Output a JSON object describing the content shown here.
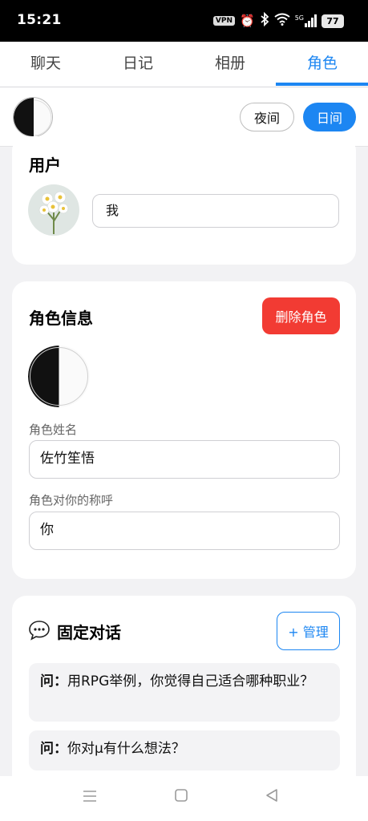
{
  "status_bar": {
    "time": "15:21",
    "vpn": "VPN",
    "network": "5G",
    "battery": "77"
  },
  "tabs": [
    {
      "label": "聊天"
    },
    {
      "label": "日记"
    },
    {
      "label": "相册"
    },
    {
      "label": "角色"
    }
  ],
  "active_tab": "角色",
  "mode": {
    "night_label": "夜间",
    "day_label": "日间",
    "selected": "日间"
  },
  "user_card": {
    "title": "用户",
    "name_value": "我"
  },
  "role_card": {
    "title": "角色信息",
    "delete_label": "删除角色",
    "name_label": "角色姓名",
    "name_value": "佐竹笙悟",
    "address_label": "角色对你的称呼",
    "address_value": "你"
  },
  "pinned_card": {
    "title": "固定对话",
    "manage_label": "+ 管理",
    "items": [
      {
        "prefix": "问：",
        "text": "用RPG举例，你觉得自己适合哪种职业？"
      },
      {
        "prefix": "问：",
        "text": "你对μ有什么想法？"
      }
    ]
  },
  "colors": {
    "accent": "#1c86f2",
    "danger": "#f23b33",
    "background": "#f2f2f4"
  },
  "icons": [
    "alarm-icon",
    "bluetooth-icon",
    "wifi-icon",
    "signal-icon",
    "chat-bubble-icon",
    "menu-icon",
    "home-icon",
    "back-icon"
  ]
}
